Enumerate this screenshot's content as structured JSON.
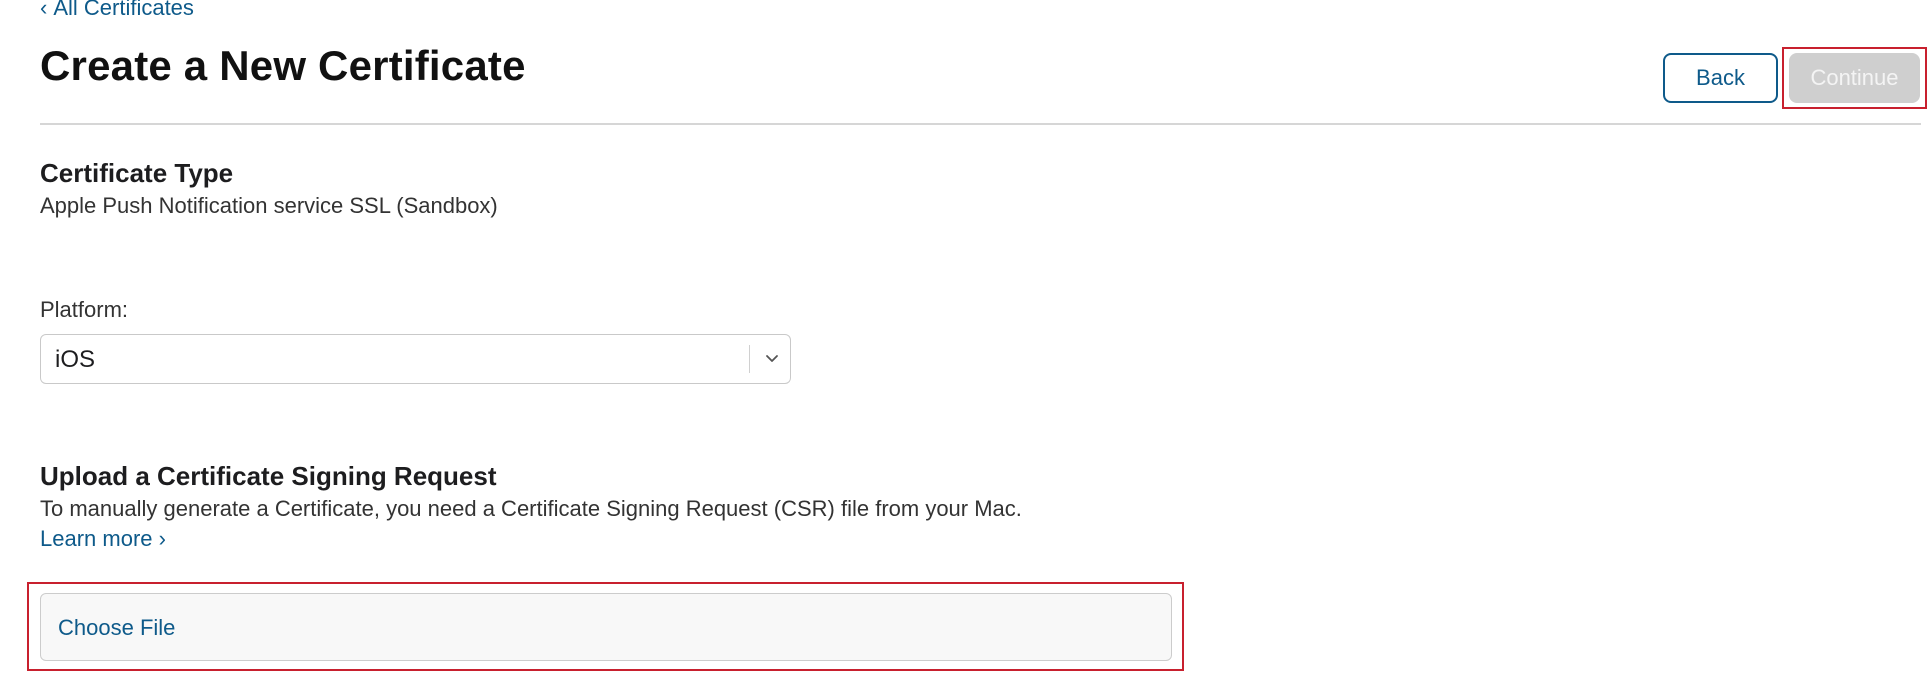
{
  "nav": {
    "back_link_chevron": "‹",
    "back_link_label": "All Certificates"
  },
  "header": {
    "title": "Create a New Certificate",
    "back_button_label": "Back",
    "continue_button_label": "Continue",
    "continue_enabled": false
  },
  "certificate_type": {
    "heading": "Certificate Type",
    "value": "Apple Push Notification service SSL (Sandbox)"
  },
  "platform": {
    "label": "Platform:",
    "selected": "iOS",
    "dropdown_icon": "chevron-down-icon"
  },
  "upload": {
    "heading": "Upload a Certificate Signing Request",
    "description": "To manually generate a Certificate, you need a Certificate Signing Request (CSR) file from your Mac.",
    "learn_more_label": "Learn more ›",
    "choose_file_label": "Choose File"
  },
  "colors": {
    "link": "#0e5a8a",
    "highlight": "#c8202e",
    "disabled_button": "#cfcfcf",
    "divider": "#d6d6d6"
  }
}
